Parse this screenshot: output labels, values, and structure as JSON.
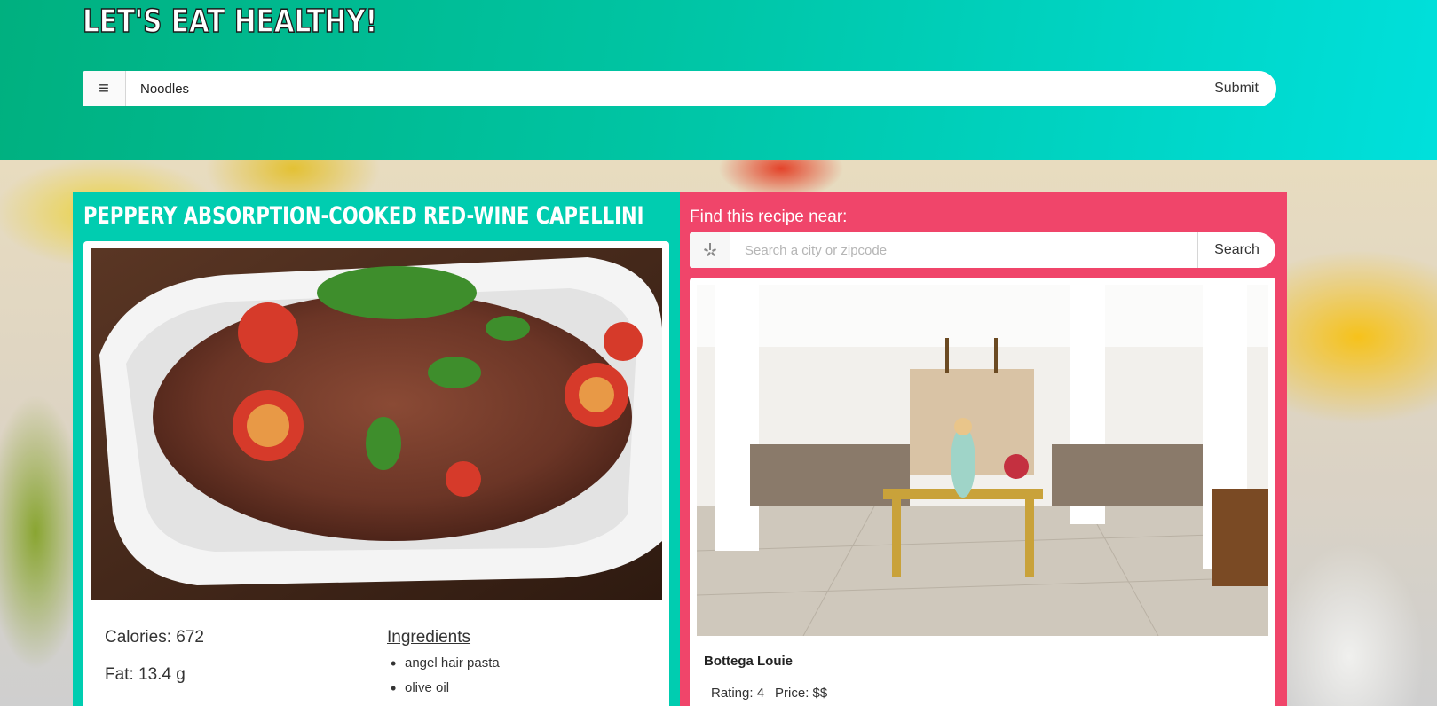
{
  "header": {
    "site_title": "LET'S EAT HEALTHY!",
    "search_value": "Noodles",
    "submit_label": "Submit",
    "menu_icon": "hamburger-menu-icon"
  },
  "recipe": {
    "title": "PEPPERY ABSORPTION-COOKED RED-WINE CAPELLINI",
    "calories": "Calories: 672",
    "fat": "Fat: 13.4 g",
    "ingredients_heading": "Ingredients",
    "ingredients": [
      "angel hair pasta",
      "olive oil"
    ]
  },
  "restaurant_search": {
    "label": "Find this recipe near:",
    "placeholder": "Search a city or zipcode",
    "button_label": "Search",
    "icon": "yelp-icon"
  },
  "restaurant": {
    "name": "Bottega Louie",
    "rating": "Rating: 4",
    "price": "Price: $$"
  },
  "colors": {
    "header_start": "#00b07f",
    "header_end": "#00e0dc",
    "recipe_panel": "#00cdb0",
    "restaurant_panel": "#f0456a"
  }
}
